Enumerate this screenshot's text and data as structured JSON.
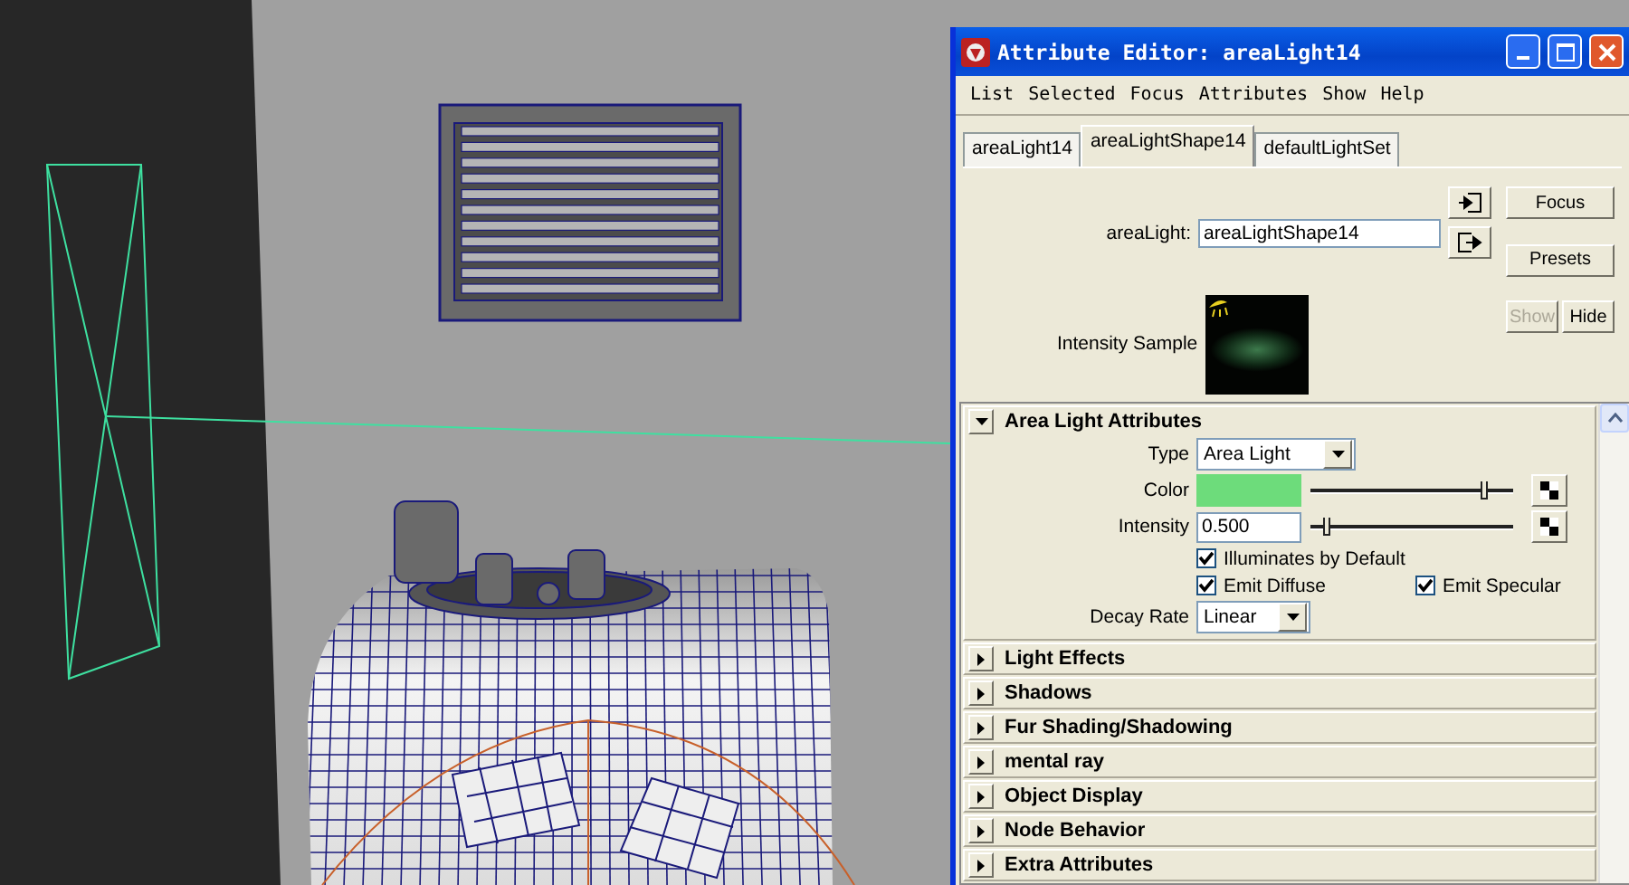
{
  "window": {
    "title": "Attribute Editor: areaLight14"
  },
  "menu": [
    "List",
    "Selected",
    "Focus",
    "Attributes",
    "Show",
    "Help"
  ],
  "tabs": [
    {
      "label": "areaLight14",
      "selected": false
    },
    {
      "label": "areaLightShape14",
      "selected": true
    },
    {
      "label": "defaultLightSet",
      "selected": false
    }
  ],
  "node": {
    "label": "areaLight:",
    "value": "areaLightShape14"
  },
  "buttons": [
    {
      "label": "Focus",
      "disabled": false
    },
    {
      "label": "Presets",
      "disabled": false
    },
    {
      "label": "Show",
      "disabled": true
    },
    {
      "label": "Hide",
      "disabled": false
    }
  ],
  "sample": {
    "label": "Intensity Sample"
  },
  "sections": [
    {
      "title": "Area Light Attributes",
      "expanded": true,
      "attributes": [
        {
          "kind": "dropdown",
          "label": "Type",
          "value": "Area Light"
        },
        {
          "kind": "color",
          "label": "Color",
          "color": "#6ddc7b",
          "level": 0.86
        },
        {
          "kind": "number",
          "label": "Intensity",
          "value": "0.500",
          "level": 0.08
        },
        {
          "kind": "checkboxes",
          "items": [
            {
              "label": "Illuminates by Default",
              "checked": true
            }
          ]
        },
        {
          "kind": "checkboxes",
          "items": [
            {
              "label": "Emit Diffuse",
              "checked": true
            },
            {
              "label": "Emit Specular",
              "checked": true
            }
          ]
        },
        {
          "kind": "dropdown",
          "label": "Decay Rate",
          "value": "Linear"
        }
      ]
    },
    {
      "title": "Light Effects",
      "expanded": false
    },
    {
      "title": "Shadows",
      "expanded": false
    },
    {
      "title": "Fur Shading/Shadowing",
      "expanded": false
    },
    {
      "title": "mental ray",
      "expanded": false
    },
    {
      "title": "Object Display",
      "expanded": false
    },
    {
      "title": "Node Behavior",
      "expanded": false
    },
    {
      "title": "Extra Attributes",
      "expanded": false
    }
  ]
}
